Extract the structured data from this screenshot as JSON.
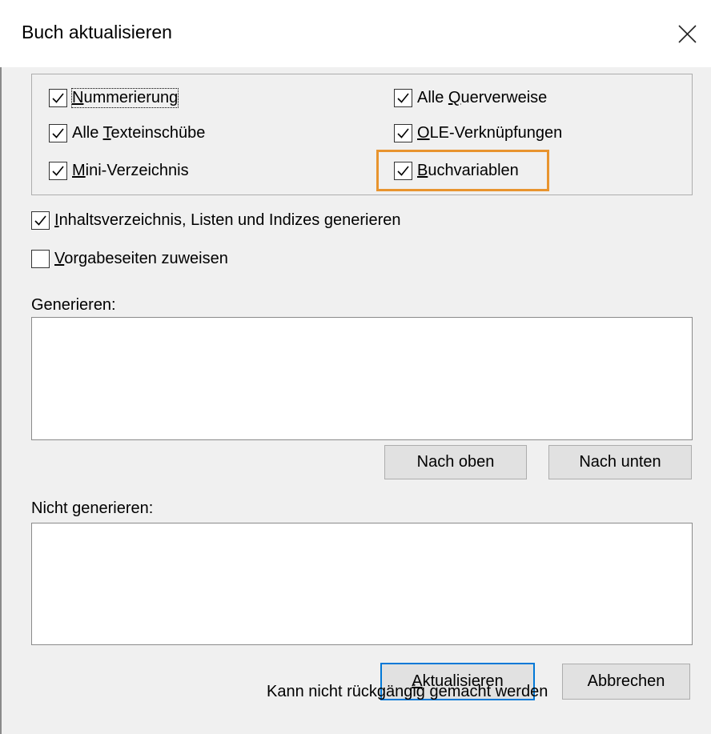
{
  "dialog": {
    "title": "Buch aktualisieren"
  },
  "group": {
    "nummerierung": {
      "pre": "",
      "key": "N",
      "post": "ummerierung",
      "checked": true
    },
    "querverweise": {
      "pre": "Alle ",
      "key": "Q",
      "post": "uerverweise",
      "checked": true
    },
    "texteinschuebe": {
      "pre": "Alle ",
      "key": "T",
      "post": "exteinschübe",
      "checked": true
    },
    "ole": {
      "pre": "",
      "key": "O",
      "post": "LE-Verknüpfungen",
      "checked": true
    },
    "mini": {
      "pre": "",
      "key": "M",
      "post": "ini-Verzeichnis",
      "checked": true
    },
    "buchvariablen": {
      "pre": "",
      "key": "B",
      "post": "uchvariablen",
      "checked": true
    }
  },
  "options": {
    "generate_toc": {
      "pre": "",
      "key": "I",
      "post": "nhaltsverzeichnis, Listen und Indizes generieren",
      "checked": true
    },
    "master_pages": {
      "pre": "",
      "key": "V",
      "post": "orgabeseiten zuweisen",
      "checked": false
    }
  },
  "generate": {
    "label": "Generieren:",
    "items": []
  },
  "buttons": {
    "move_up": "Nach oben",
    "move_down": "Nach unten",
    "update_key": "A",
    "update_rest": "ktualisieren",
    "cancel": "Abbrechen"
  },
  "not_generate": {
    "label": "Nicht generieren:",
    "items": []
  },
  "footer": {
    "note": "Kann nicht rückgängig gemacht werden"
  },
  "colors": {
    "highlight": "#e8942e",
    "primary_border": "#0078d7",
    "dialog_bg": "#f0f0f0"
  },
  "icons": {
    "close": "close-icon",
    "check": "checkmark-icon"
  }
}
